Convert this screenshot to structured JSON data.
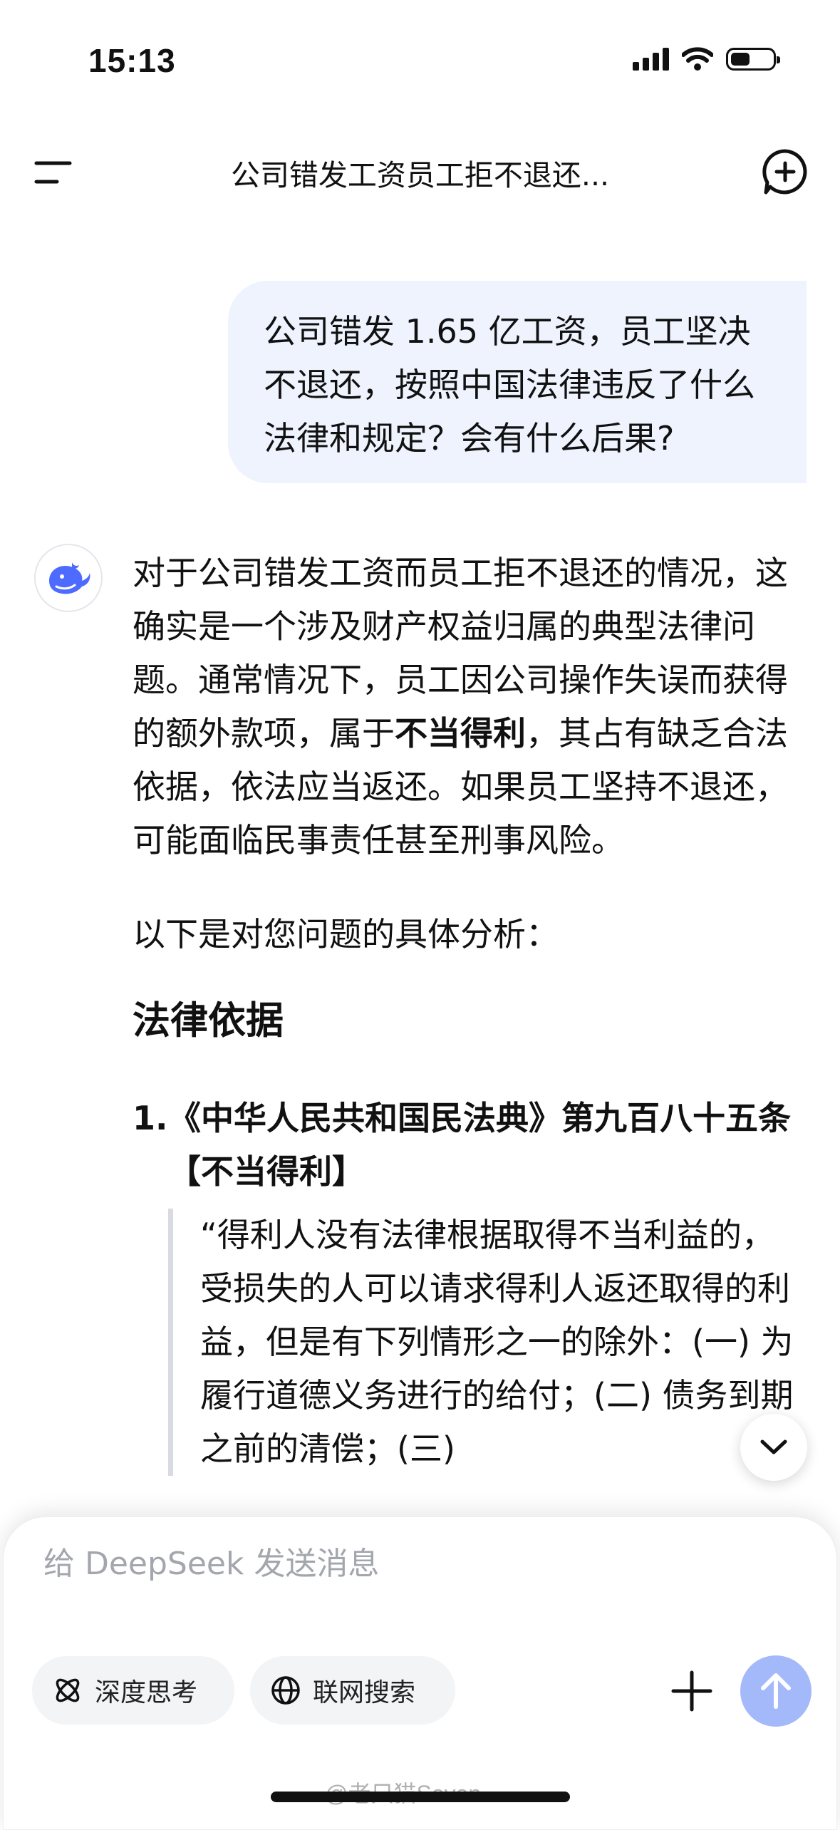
{
  "status_bar": {
    "time": "15:13"
  },
  "header": {
    "title": "公司错发工资员工拒不退还..."
  },
  "user_message": "公司错发 1.65 亿工资，员工坚决不退还，按照中国法律违反了什么法律和规定？会有什么后果?",
  "assistant": {
    "p1_a": "对于公司错发工资而员工拒不退还的情况，这确实是一个涉及财产权益归属的典型法律问题。通常情况下，员工因公司操作失误而获得的额外款项，属于",
    "p1_bold": "不当得利",
    "p1_b": "，其占有缺乏合法依据，依法应当返还。如果员工坚持不退还，可能面临民事责任甚至刑事风险。",
    "p2": "以下是对您问题的具体分析：",
    "heading": "法律依据",
    "law_number": "1.",
    "law_title": "《中华人民共和国民法典》第九百八十五条【不当得利】",
    "quote": "“得利人没有法律根据取得不当利益的，受损失的人可以请求得利人返还取得的利益，但是有下列情形之一的除外：(一) 为履行道德义务进行的给付；(二) 债务到期之前的清偿；(三)"
  },
  "composer": {
    "placeholder": "给 DeepSeek 发送消息",
    "deep_think_label": "深度思考",
    "web_search_label": "联网搜索"
  },
  "watermark": "@老只猫Seven",
  "colors": {
    "user_bubble": "#EEF3FE",
    "send_button": "#A4B9F9",
    "brand_blue": "#4D6BFE"
  }
}
